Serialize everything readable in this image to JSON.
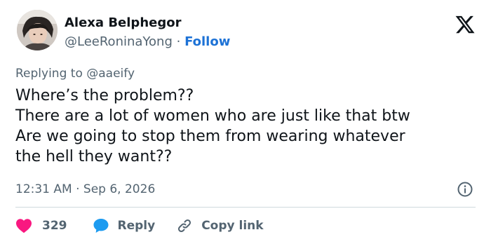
{
  "author": {
    "name": "Alexa Belphegor",
    "handle": "@LeeRoninaYong",
    "separator": "·",
    "follow_label": "Follow"
  },
  "reply_context": {
    "prefix": "Replying to",
    "handle": "@aaeify"
  },
  "tweet": {
    "lines": [
      "Where’s the problem??",
      "There are a lot of women who are just like that btw",
      "Are we going to stop them from wearing whatever",
      "the hell they want??"
    ]
  },
  "meta": {
    "time": "12:31 AM",
    "separator": "·",
    "date": "Sep 6, 2026"
  },
  "actions": {
    "like_count": "329",
    "reply_label": "Reply",
    "copy_label": "Copy link"
  },
  "icons": {
    "brand": "x-logo-icon",
    "info": "info-icon",
    "like": "heart-icon",
    "reply": "speech-bubble-icon",
    "copy": "link-icon"
  },
  "colors": {
    "link": "#1d72d6",
    "like": "#f91880",
    "reply": "#1d9bf0",
    "muted": "#536471",
    "text": "#0f1419",
    "divider": "#cfd9de"
  }
}
